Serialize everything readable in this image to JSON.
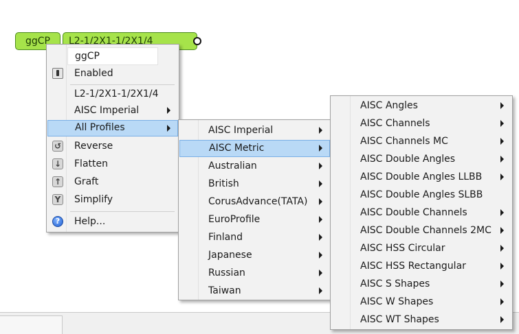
{
  "component": {
    "name": "ggCP",
    "value": "L2-1/2X1-1/2X1/4"
  },
  "context_menu": {
    "header": "ggCP",
    "items": [
      {
        "label": "Enabled",
        "icon": "toggle-icon"
      },
      {
        "label": "L2-1/2X1-1/2X1/4"
      },
      {
        "label": "AISC Imperial",
        "submenu": true
      },
      {
        "label": "All Profiles",
        "submenu": true,
        "highlighted": true
      },
      {
        "label": "Reverse",
        "icon": "reverse-icon"
      },
      {
        "label": "Flatten",
        "icon": "flatten-icon"
      },
      {
        "label": "Graft",
        "icon": "graft-icon"
      },
      {
        "label": "Simplify",
        "icon": "simplify-icon"
      },
      {
        "label": "Help...",
        "icon": "help-icon"
      }
    ]
  },
  "profiles_menu": {
    "items": [
      {
        "label": "AISC Imperial"
      },
      {
        "label": "AISC Metric",
        "highlighted": true
      },
      {
        "label": "Australian"
      },
      {
        "label": "British"
      },
      {
        "label": "CorusAdvance(TATA)"
      },
      {
        "label": "EuroProfile"
      },
      {
        "label": "Finland"
      },
      {
        "label": "Japanese"
      },
      {
        "label": "Russian"
      },
      {
        "label": "Taiwan"
      }
    ]
  },
  "metric_menu": {
    "items": [
      {
        "label": "AISC Angles",
        "submenu": true
      },
      {
        "label": "AISC Channels",
        "submenu": true
      },
      {
        "label": "AISC Channels MC",
        "submenu": true
      },
      {
        "label": "AISC Double Angles",
        "submenu": true
      },
      {
        "label": "AISC Double Angles LLBB",
        "submenu": true
      },
      {
        "label": "AISC Double Angles SLBB",
        "submenu": false
      },
      {
        "label": "AISC Double Channels",
        "submenu": true
      },
      {
        "label": "AISC Double Channels 2MC",
        "submenu": true
      },
      {
        "label": "AISC HSS Circular",
        "submenu": true
      },
      {
        "label": "AISC HSS Rectangular",
        "submenu": true
      },
      {
        "label": "AISC S Shapes",
        "submenu": true
      },
      {
        "label": "AISC W Shapes",
        "submenu": true
      },
      {
        "label": "AISC WT Shapes",
        "submenu": true
      }
    ]
  },
  "icon_glyphs": {
    "reverse": "↺",
    "flatten": "↓",
    "graft": "↑",
    "simplify": "Y",
    "help": "?"
  },
  "colors": {
    "component_green": "#a6e34a",
    "highlight": "#b9d9f6"
  }
}
